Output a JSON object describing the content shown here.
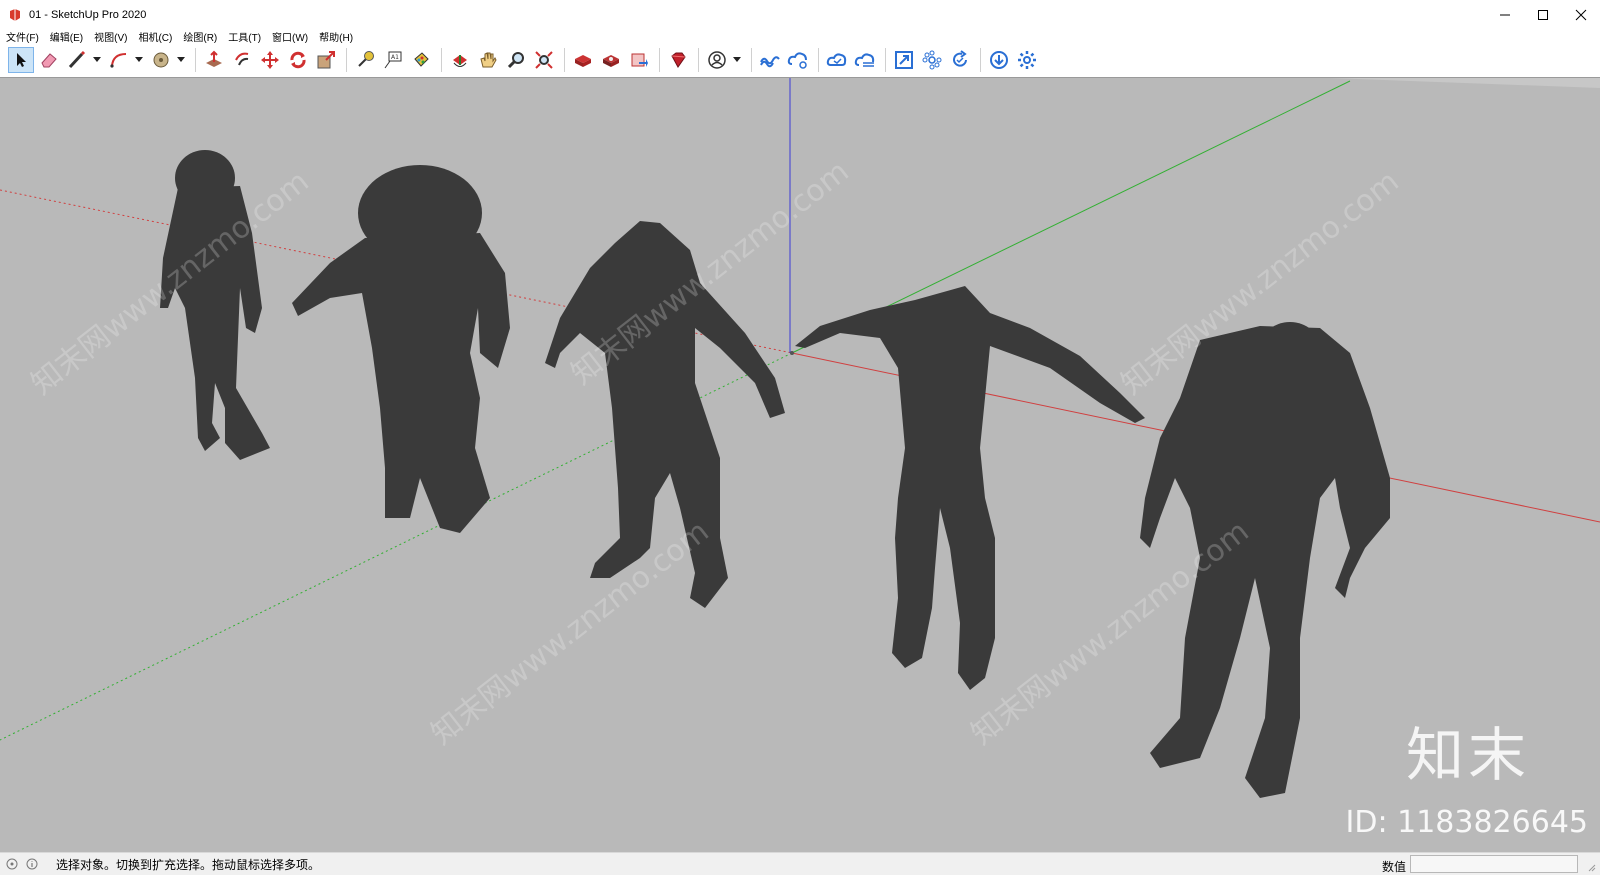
{
  "window": {
    "title": "01 - SketchUp Pro 2020",
    "minimize_glyph": "—",
    "maximize_glyph": "☐",
    "close_glyph": "✕"
  },
  "menu": [
    "文件(F)",
    "编辑(E)",
    "视图(V)",
    "相机(C)",
    "绘图(R)",
    "工具(T)",
    "窗口(W)",
    "帮助(H)"
  ],
  "toolbar": {
    "groups": [
      [
        "select-icon",
        "eraser-icon",
        "line-icon",
        "arc-icon",
        "shapes-icon"
      ],
      [
        "push-pull-icon",
        "offset-icon",
        "move-icon",
        "rotate-icon",
        "scale-icon"
      ],
      [
        "tape-measure-icon",
        "text-icon",
        "paint-bucket-icon"
      ],
      [
        "orbit-icon",
        "pan-icon",
        "zoom-icon",
        "zoom-extents-icon"
      ],
      [
        "warehouse-icon",
        "extension-warehouse-icon",
        "layout-icon"
      ],
      [
        "ruby-icon"
      ],
      [
        "profile-icon"
      ],
      [
        "trimble-connect-icon",
        "share-icon",
        "cloud-sync-icon",
        "cloud-collab-icon"
      ],
      [
        "expand-icon",
        "components-icon",
        "refresh-icon"
      ],
      [
        "download-icon",
        "settings-icon"
      ]
    ]
  },
  "viewport": {
    "background": "#b9b9b9",
    "watermark_brand": "知末",
    "watermark_id": "ID: 1183826645",
    "watermark_diag": "知末网www.znzmo.com"
  },
  "status": {
    "text": "选择对象。切换到扩充选择。拖动鼠标选择多项。",
    "measure_label": "数值",
    "measure_value": ""
  },
  "colors": {
    "axis_red": "#d04040",
    "axis_green": "#33b033",
    "axis_blue": "#3a3ad8",
    "model": "#3a3a3a",
    "accent": "#2a7fd4"
  }
}
